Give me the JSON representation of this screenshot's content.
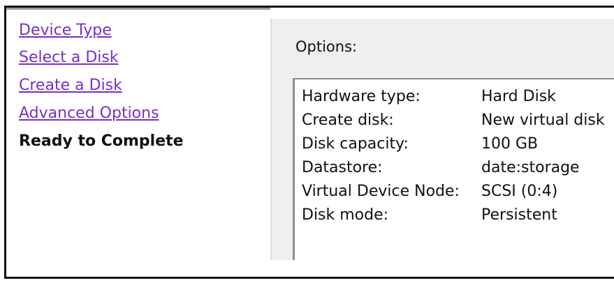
{
  "nav": {
    "items": [
      {
        "label": "Device Type",
        "state": "link"
      },
      {
        "label": "Select a Disk",
        "state": "link"
      },
      {
        "label": "Create a Disk",
        "state": "link"
      },
      {
        "label": "Advanced Options",
        "state": "link"
      },
      {
        "label": "Ready to Complete",
        "state": "current"
      }
    ]
  },
  "main": {
    "options_label": "Options:",
    "summary": [
      {
        "key": "Hardware type:",
        "value": "Hard Disk"
      },
      {
        "key": "Create disk:",
        "value": "New virtual disk"
      },
      {
        "key": "Disk capacity:",
        "value": "100 GB"
      },
      {
        "key": "Datastore:",
        "value": "date:storage"
      },
      {
        "key": "Virtual Device Node:",
        "value": "SCSI (0:4)"
      },
      {
        "key": "Disk mode:",
        "value": "Persistent"
      }
    ]
  },
  "colors": {
    "link": "#7a2ec9",
    "panel_background": "#efefef",
    "border": "#111111"
  }
}
